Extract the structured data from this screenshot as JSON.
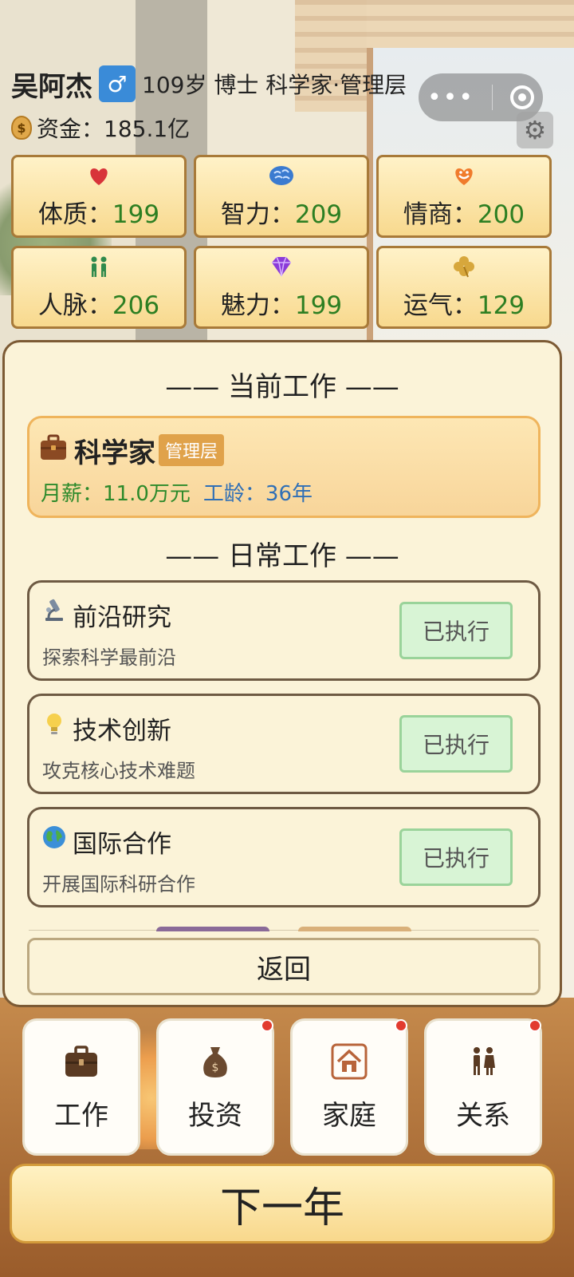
{
  "player": {
    "name": "吴阿杰",
    "gender_symbol": "♂",
    "summary": "109岁 博士 科学家·管理层",
    "money_label": "资金：185.1亿"
  },
  "stats": [
    {
      "icon": "heart-icon",
      "label": "体质：",
      "value": "199",
      "color": "#d8343a"
    },
    {
      "icon": "brain-icon",
      "label": "智力：",
      "value": "209",
      "color": "#3b7bd0"
    },
    {
      "icon": "smile-heart-icon",
      "label": "情商：",
      "value": "200",
      "color": "#f07b2c"
    },
    {
      "icon": "people-icon",
      "label": "人脉：",
      "value": "206",
      "color": "#2f8a4c"
    },
    {
      "icon": "diamond-icon",
      "label": "魅力：",
      "value": "199",
      "color": "#8b3bd8"
    },
    {
      "icon": "clover-icon",
      "label": "运气：",
      "value": "129",
      "color": "#d7a73c"
    }
  ],
  "panel": {
    "current_title": "—— 当前工作 ——",
    "job": {
      "title": "科学家",
      "tag": "管理层",
      "salary": "月薪：11.0万元",
      "years": "工龄：36年"
    },
    "daily_title": "—— 日常工作 ——",
    "tasks": [
      {
        "icon": "microscope-icon",
        "title": "前沿研究",
        "desc": "探索科学最前沿",
        "button": "已执行"
      },
      {
        "icon": "lightbulb-icon",
        "title": "技术创新",
        "desc": "攻克核心技术难题",
        "button": "已执行"
      },
      {
        "icon": "globe-icon",
        "title": "国际合作",
        "desc": "开展国际科研合作",
        "button": "已执行"
      }
    ],
    "back_label": "返回"
  },
  "nav": [
    {
      "icon": "briefcase-icon",
      "label": "工作",
      "badge": false
    },
    {
      "icon": "moneybag-icon",
      "label": "投资",
      "badge": true
    },
    {
      "icon": "house-icon",
      "label": "家庭",
      "badge": true
    },
    {
      "icon": "couple-icon",
      "label": "关系",
      "badge": true
    }
  ],
  "next_year_label": "下一年",
  "colors": {
    "stat_value": "#2d7f22",
    "accent_panel": "#fbf3d8",
    "done_button": "#d8f4d5"
  }
}
